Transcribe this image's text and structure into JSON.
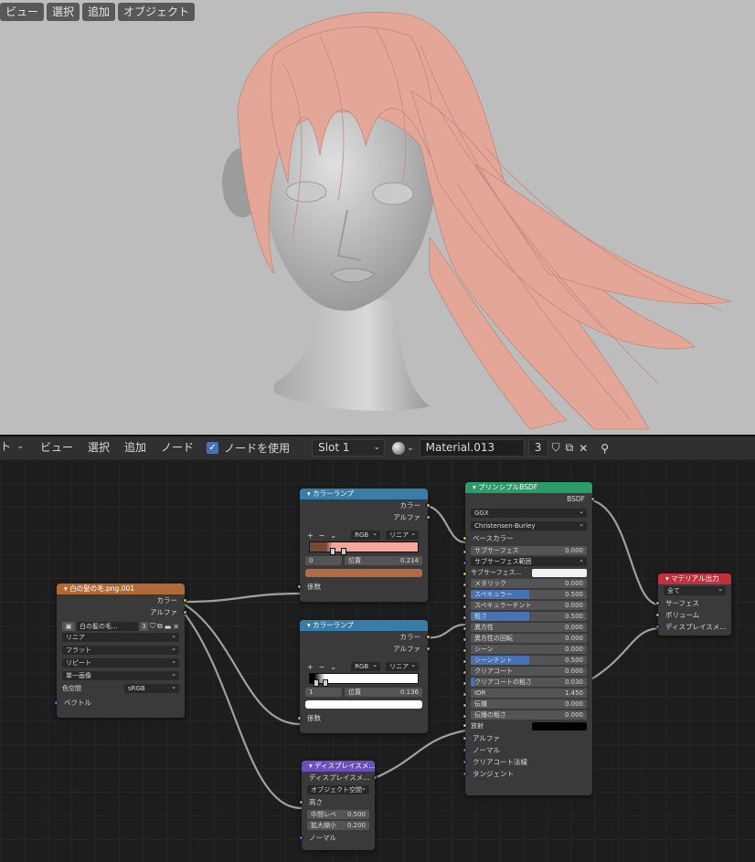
{
  "viewport": {
    "menu": [
      "ビュー",
      "選択",
      "追加",
      "オブジェクト"
    ]
  },
  "header": {
    "left_dd": "ト",
    "menu": [
      "ビュー",
      "選択",
      "追加",
      "ノード"
    ],
    "use_nodes": "ノードを使用",
    "slot": "Slot 1",
    "material": "Material.013",
    "users": "3"
  },
  "nodes": {
    "image": {
      "title": "白の髪の毛.png.001",
      "out": [
        "カラー",
        "アルファ"
      ],
      "img_name": "白の髪の毛...",
      "img_users": "3",
      "interp": "リニア",
      "proj": "フラット",
      "ext": "リピート",
      "src": "単一画像",
      "cs_label": "色空間",
      "cs_val": "sRGB",
      "vec": "ベクトル"
    },
    "ramp1": {
      "title": "カラーランプ",
      "out": [
        "カラー",
        "アルファ"
      ],
      "plus": "+",
      "minus": "−",
      "mode": "RGB",
      "interp": "リニア",
      "idx": "0",
      "pos_label": "位置",
      "pos_val": "0.214",
      "fac": "係数"
    },
    "ramp2": {
      "title": "カラーランプ",
      "out": [
        "カラー",
        "アルファ"
      ],
      "plus": "+",
      "minus": "−",
      "mode": "RGB",
      "interp": "リニア",
      "idx": "1",
      "pos_label": "位置",
      "pos_val": "0.136",
      "fac": "係数"
    },
    "disp": {
      "title": "ディスプレイスメ...",
      "out": "ディスプレイスメ...",
      "space": "オブジェクト空間",
      "height": "高さ",
      "mid_label": "中間レベ",
      "mid_val": "0.500",
      "scale_label": "拡大縮小",
      "scale_val": "0.200",
      "normal": "ノーマル"
    },
    "bsdf": {
      "title": "プリンシプルBSDF",
      "out": "BSDF",
      "dist": "GGX",
      "ss_method": "Christensen-Burley",
      "base": "ベースカラー",
      "fields": [
        {
          "l": "サブサーフェス",
          "v": "0.000",
          "f": 0,
          "t": "fld",
          "s": "gry"
        },
        {
          "l": "サブサーフェス範囲",
          "v": "",
          "f": 0,
          "t": "sel",
          "s": "pur"
        },
        {
          "l": "サブサーフェス...",
          "v": "",
          "f": 0,
          "t": "sw",
          "s": "yel"
        },
        {
          "l": "メタリック",
          "v": "0.000",
          "f": 0,
          "t": "fld",
          "s": "gry"
        },
        {
          "l": "スペキュラー",
          "v": "0.500",
          "f": 0.5,
          "t": "fld",
          "s": "gry"
        },
        {
          "l": "スペキュラーチント",
          "v": "0.000",
          "f": 0,
          "t": "fld",
          "s": "gry"
        },
        {
          "l": "粗さ",
          "v": "0.500",
          "f": 0.5,
          "t": "fld",
          "s": "gry"
        },
        {
          "l": "異方性",
          "v": "0.000",
          "f": 0,
          "t": "fld",
          "s": "gry"
        },
        {
          "l": "異方性の回転",
          "v": "0.000",
          "f": 0,
          "t": "fld",
          "s": "gry"
        },
        {
          "l": "シーン",
          "v": "0.000",
          "f": 0,
          "t": "fld",
          "s": "gry"
        },
        {
          "l": "シーンチント",
          "v": "0.500",
          "f": 0.5,
          "t": "fld",
          "s": "gry"
        },
        {
          "l": "クリアコート",
          "v": "0.000",
          "f": 0,
          "t": "fld",
          "s": "gry"
        },
        {
          "l": "クリアコートの粗さ",
          "v": "0.030",
          "f": 0.03,
          "t": "fld",
          "s": "gry"
        },
        {
          "l": "IOR",
          "v": "1.450",
          "f": 0,
          "t": "fld",
          "s": "gry"
        },
        {
          "l": "伝播",
          "v": "0.000",
          "f": 0,
          "t": "fld",
          "s": "gry"
        },
        {
          "l": "伝播の粗さ",
          "v": "0.000",
          "f": 0,
          "t": "fld",
          "s": "gry"
        }
      ],
      "emit": "放射",
      "inputs": [
        "アルファ",
        "ノーマル",
        "クリアコート法線",
        "タンジェント"
      ]
    },
    "out": {
      "title": "マテリアル出力",
      "target": "全て",
      "inputs": [
        "サーフェス",
        "ボリューム",
        "ディスプレイスメ..."
      ]
    }
  },
  "colors": {
    "image": "#b06a3a",
    "ramp": "#3a7ca5",
    "disp": "#6a4fbf",
    "bsdf": "#2d9a69",
    "out": "#c0303d",
    "ramp1_color": "#b36b45",
    "ramp1_right": "#f5a898",
    "ramp1_left": "#7a4a30"
  }
}
